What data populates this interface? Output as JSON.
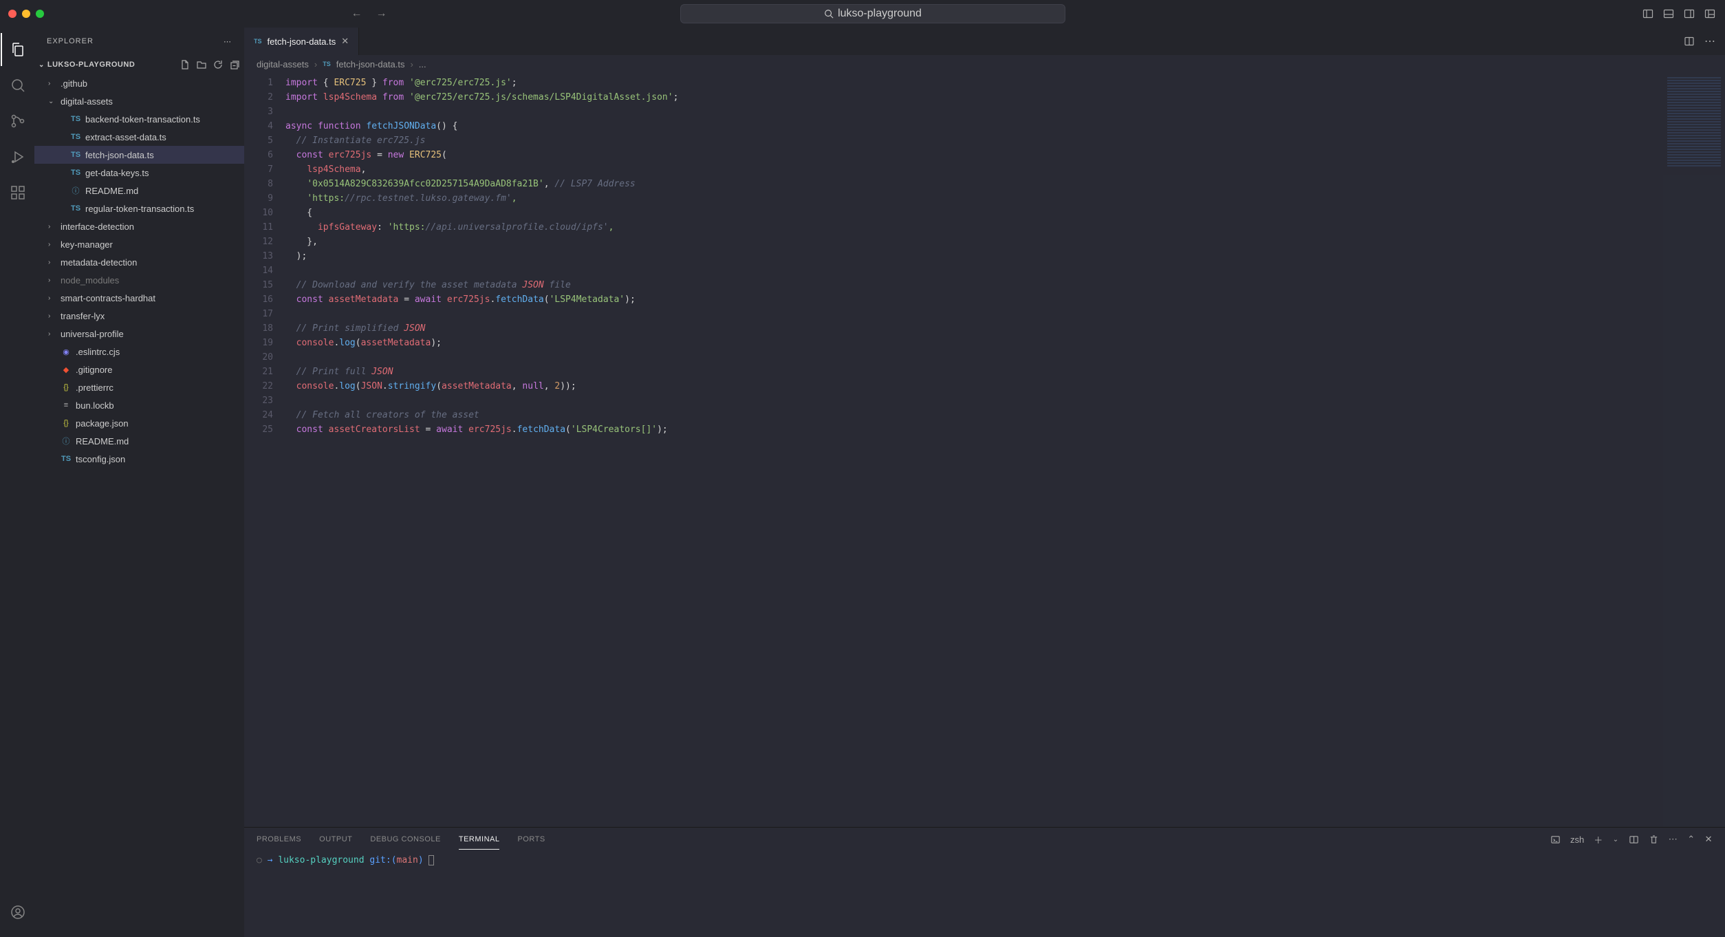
{
  "window": {
    "search_text": "lukso-playground"
  },
  "sidebar": {
    "title": "EXPLORER",
    "project": "LUKSO-PLAYGROUND",
    "tree": [
      {
        "type": "folder",
        "name": ".github",
        "indent": 1
      },
      {
        "type": "folder-open",
        "name": "digital-assets",
        "indent": 1
      },
      {
        "type": "ts",
        "name": "backend-token-transaction.ts",
        "indent": 2
      },
      {
        "type": "ts",
        "name": "extract-asset-data.ts",
        "indent": 2
      },
      {
        "type": "ts",
        "name": "fetch-json-data.ts",
        "indent": 2,
        "active": true
      },
      {
        "type": "ts",
        "name": "get-data-keys.ts",
        "indent": 2
      },
      {
        "type": "info",
        "name": "README.md",
        "indent": 2
      },
      {
        "type": "ts",
        "name": "regular-token-transaction.ts",
        "indent": 2
      },
      {
        "type": "folder",
        "name": "interface-detection",
        "indent": 1
      },
      {
        "type": "folder",
        "name": "key-manager",
        "indent": 1
      },
      {
        "type": "folder",
        "name": "metadata-detection",
        "indent": 1
      },
      {
        "type": "folder",
        "name": "node_modules",
        "indent": 1,
        "dim": true
      },
      {
        "type": "folder",
        "name": "smart-contracts-hardhat",
        "indent": 1
      },
      {
        "type": "folder",
        "name": "transfer-lyx",
        "indent": 1
      },
      {
        "type": "folder",
        "name": "universal-profile",
        "indent": 1
      },
      {
        "type": "eslint",
        "name": ".eslintrc.cjs",
        "indent": 1
      },
      {
        "type": "git",
        "name": ".gitignore",
        "indent": 1
      },
      {
        "type": "json",
        "name": ".prettierrc",
        "indent": 1
      },
      {
        "type": "file",
        "name": "bun.lockb",
        "indent": 1
      },
      {
        "type": "json",
        "name": "package.json",
        "indent": 1
      },
      {
        "type": "info",
        "name": "README.md",
        "indent": 1
      },
      {
        "type": "ts",
        "name": "tsconfig.json",
        "indent": 1
      }
    ]
  },
  "tab": {
    "icon": "TS",
    "filename": "fetch-json-data.ts"
  },
  "breadcrumb": {
    "folder": "digital-assets",
    "file": "fetch-json-data.ts",
    "symbol": "..."
  },
  "code": {
    "lines": [
      "import { ERC725 } from '@erc725/erc725.js';",
      "import lsp4Schema from '@erc725/erc725.js/schemas/LSP4DigitalAsset.json';",
      "",
      "async function fetchJSONData() {",
      "  // Instantiate erc725.js",
      "  const erc725js = new ERC725(",
      "    lsp4Schema,",
      "    '0x0514A829C832639Afcc02D257154A9DaAD8fa21B', // LSP7 Address",
      "    'https://rpc.testnet.lukso.gateway.fm',",
      "    {",
      "      ipfsGateway: 'https://api.universalprofile.cloud/ipfs',",
      "    },",
      "  );",
      "",
      "  // Download and verify the asset metadata JSON file",
      "  const assetMetadata = await erc725js.fetchData('LSP4Metadata');",
      "",
      "  // Print simplified JSON",
      "  console.log(assetMetadata);",
      "",
      "  // Print full JSON",
      "  console.log(JSON.stringify(assetMetadata, null, 2));",
      "",
      "  // Fetch all creators of the asset",
      "  const assetCreatorsList = await erc725js.fetchData('LSP4Creators[]');"
    ]
  },
  "panel": {
    "tabs": [
      "PROBLEMS",
      "OUTPUT",
      "DEBUG CONSOLE",
      "TERMINAL",
      "PORTS"
    ],
    "active_tab": "TERMINAL",
    "shell": "zsh",
    "prompt": {
      "path": "lukso-playground",
      "git_label": "git:",
      "branch": "main"
    }
  }
}
